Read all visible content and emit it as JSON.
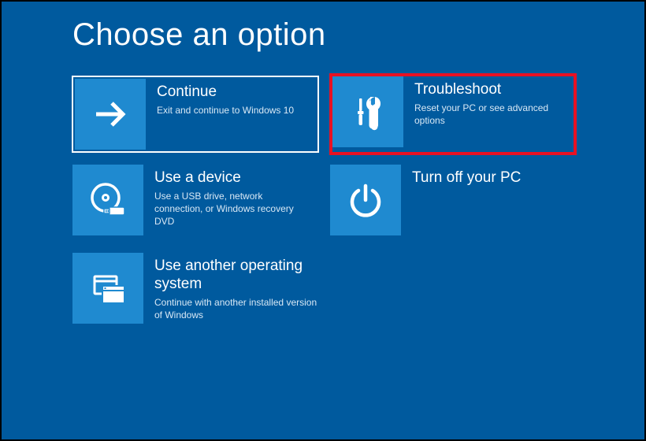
{
  "page": {
    "title": "Choose an option"
  },
  "tiles": {
    "continue": {
      "title": "Continue",
      "desc": "Exit and continue to Windows 10"
    },
    "troubleshoot": {
      "title": "Troubleshoot",
      "desc": "Reset your PC or see advanced options"
    },
    "use_device": {
      "title": "Use a device",
      "desc": "Use a USB drive, network connection, or Windows recovery DVD"
    },
    "turn_off": {
      "title": "Turn off your PC",
      "desc": ""
    },
    "use_another_os": {
      "title": "Use another operating system",
      "desc": "Continue with another installed version of Windows"
    }
  }
}
